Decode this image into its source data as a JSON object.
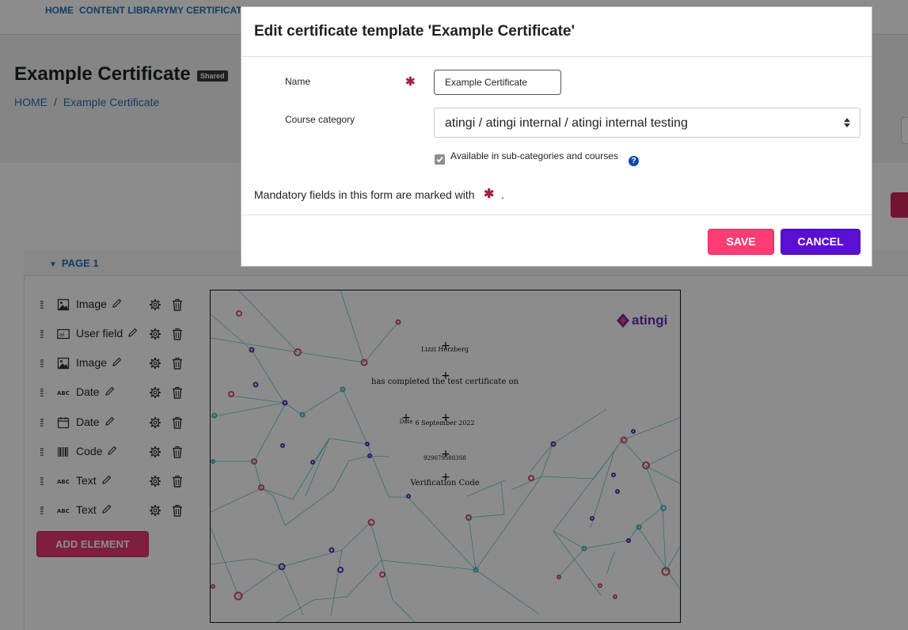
{
  "nav": {
    "items": [
      "HOME",
      "CONTENT LIBRARY",
      "MY CERTIFICATES",
      "..."
    ]
  },
  "page": {
    "title": "Example Certificate",
    "badge": "Shared",
    "breadcrumb": [
      "HOME",
      "Example Certificate"
    ]
  },
  "editor": {
    "page_label": "PAGE 1",
    "elements": [
      {
        "label": "Image",
        "icon": "image-icon"
      },
      {
        "label": "User field",
        "icon": "user-field-icon"
      },
      {
        "label": "Image",
        "icon": "image-icon"
      },
      {
        "label": "Date",
        "icon": "text-abc-icon"
      },
      {
        "label": "Date",
        "icon": "calendar-icon"
      },
      {
        "label": "Code",
        "icon": "barcode-icon"
      },
      {
        "label": "Text",
        "icon": "text-abc-icon"
      },
      {
        "label": "Text",
        "icon": "text-abc-icon"
      }
    ],
    "add_element_label": "ADD ELEMENT"
  },
  "certificate": {
    "logo_text": "atingi",
    "recipient_name": "Lizzi Herzberg",
    "completed_text": "has completed the test certificate on",
    "date_label": "Date",
    "date_value": "6 September 2022",
    "code_value": "9296795883S8",
    "verification_label": "Verification Code"
  },
  "modal": {
    "title": "Edit certificate template 'Example Certificate'",
    "name_label": "Name",
    "name_value": "Example Certificate",
    "category_label": "Course category",
    "category_value": "atingi / atingi internal / atingi internal testing",
    "available_label": "Available in sub-categories and courses",
    "available_checked": true,
    "mandatory_text": "Mandatory fields in this form are marked with",
    "mandatory_suffix": ".",
    "save_label": "SAVE",
    "cancel_label": "CANCEL"
  },
  "colors": {
    "accent_blue": "#1f6fb8",
    "save_pink": "#ff3c73",
    "cancel_purple": "#5b0fd1",
    "required_red": "#a0233f"
  }
}
